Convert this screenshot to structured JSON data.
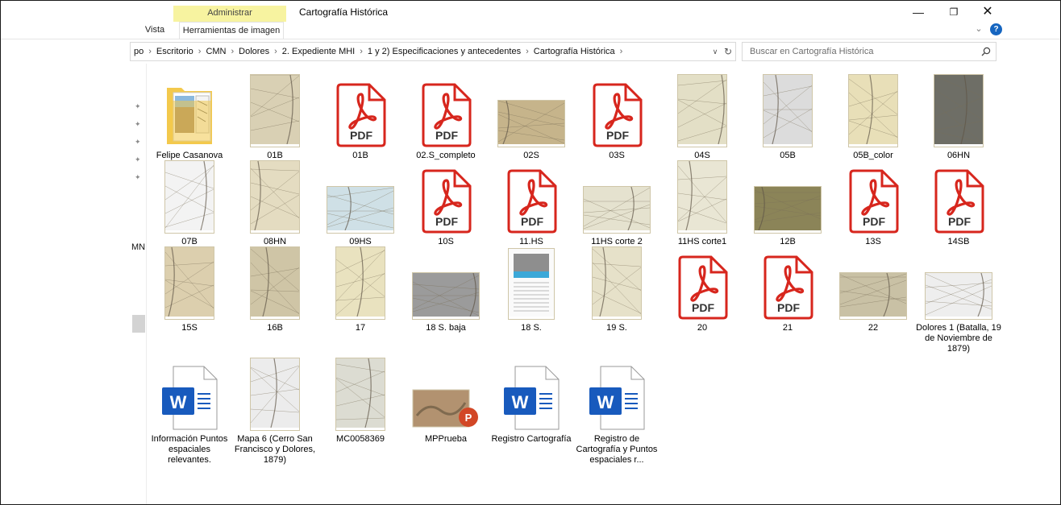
{
  "window": {
    "title": "Cartografía Histórica",
    "contextual_tab_group": "Administrar",
    "tabs": [
      "Vista",
      "Herramientas de imagen"
    ],
    "minimize_glyph": "—",
    "maximize_glyph": "❐",
    "close_glyph": "✕",
    "chevron_glyph": "⌄",
    "help_glyph": "?"
  },
  "address": {
    "crumbs": [
      "po",
      "Escritorio",
      "CMN",
      "Dolores",
      "2. Expediente MHI",
      "1 y 2) Especificaciones y antecedentes",
      "Cartografía Histórica"
    ],
    "separator": "›",
    "dropdown_glyph": "∨",
    "refresh_glyph": "↻"
  },
  "search": {
    "placeholder": "Buscar en Cartografía Histórica"
  },
  "nav": {
    "partial_label": "MN",
    "pin_glyph": "✦"
  },
  "colors": {
    "pdf_red": "#d7261d",
    "word_blue": "#185abd",
    "ppt_orange": "#d24726",
    "folder_yellow": "#f3c94d",
    "admin_tab": "#f7f3a0"
  },
  "files": [
    {
      "name": "Felipe Casanova",
      "kind": "folder"
    },
    {
      "name": "01B",
      "kind": "map",
      "tone": "#d9d0b4"
    },
    {
      "name": "01B",
      "kind": "pdf"
    },
    {
      "name": "02.S_completo",
      "kind": "pdf"
    },
    {
      "name": "02S",
      "kind": "map-wide",
      "tone": "#c6b48b"
    },
    {
      "name": "03S",
      "kind": "pdf"
    },
    {
      "name": "04S",
      "kind": "map",
      "tone": "#e3dfc6"
    },
    {
      "name": "05B",
      "kind": "map",
      "tone": "#dcdcdc"
    },
    {
      "name": "05B_color",
      "kind": "map",
      "tone": "#e8dfb8"
    },
    {
      "name": "06HN",
      "kind": "map",
      "tone": "#6e6e66"
    },
    {
      "name": "07B",
      "kind": "map",
      "tone": "#f3f3f3"
    },
    {
      "name": "08HN",
      "kind": "map",
      "tone": "#e4dcc1"
    },
    {
      "name": "09HS",
      "kind": "map-wide",
      "tone": "#cfe0e6"
    },
    {
      "name": "10S",
      "kind": "pdf"
    },
    {
      "name": "11.HS",
      "kind": "pdf"
    },
    {
      "name": "11HS corte 2",
      "kind": "map-wide",
      "tone": "#e5e2cf"
    },
    {
      "name": "11HS corte1",
      "kind": "map",
      "tone": "#e9e6d4"
    },
    {
      "name": "12B",
      "kind": "map-wide",
      "tone": "#8b8458"
    },
    {
      "name": "13S",
      "kind": "pdf"
    },
    {
      "name": "14SB",
      "kind": "pdf"
    },
    {
      "name": "15S",
      "kind": "map",
      "tone": "#dccfae"
    },
    {
      "name": "16B",
      "kind": "map",
      "tone": "#cfc5a6"
    },
    {
      "name": "17",
      "kind": "map",
      "tone": "#e9e2bf"
    },
    {
      "name": "18 S. baja",
      "kind": "map-wide",
      "tone": "#9b9b9b"
    },
    {
      "name": "18 S.",
      "kind": "doc",
      "tone": "#f4f4f4"
    },
    {
      "name": "19 S.",
      "kind": "map",
      "tone": "#e6e1c9"
    },
    {
      "name": "20",
      "kind": "pdf"
    },
    {
      "name": "21",
      "kind": "pdf"
    },
    {
      "name": "22",
      "kind": "map-wide",
      "tone": "#c9c1a5"
    },
    {
      "name": "Dolores 1 (Batalla, 19 de Noviembre de 1879)",
      "kind": "map-wide",
      "tone": "#eeeeee"
    },
    {
      "name": "Información Puntos espaciales relevantes.",
      "kind": "word"
    },
    {
      "name": "Mapa 6 (Cerro San Francisco y Dolores, 1879)",
      "kind": "map",
      "tone": "#ececec"
    },
    {
      "name": "MC0058369",
      "kind": "map",
      "tone": "#dcdcd2"
    },
    {
      "name": "MPPrueba",
      "kind": "ppt"
    },
    {
      "name": "Registro Cartografía",
      "kind": "word"
    },
    {
      "name": "Registro de Cartografía y Puntos espaciales r...",
      "kind": "word"
    }
  ]
}
